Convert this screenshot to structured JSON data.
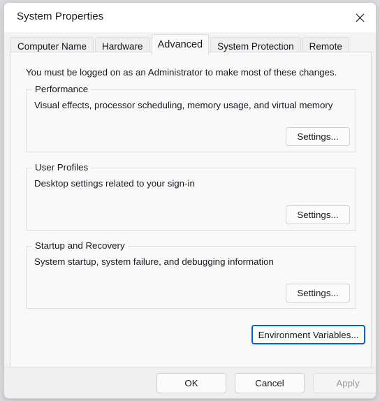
{
  "window": {
    "title": "System Properties",
    "close_icon": "close-icon"
  },
  "tabs": [
    {
      "label": "Computer Name",
      "active": false
    },
    {
      "label": "Hardware",
      "active": false
    },
    {
      "label": "Advanced",
      "active": true
    },
    {
      "label": "System Protection",
      "active": false
    },
    {
      "label": "Remote",
      "active": false
    }
  ],
  "panel": {
    "admin_note": "You must be logged on as an Administrator to make most of these changes.",
    "groups": [
      {
        "legend": "Performance",
        "description": "Visual effects, processor scheduling, memory usage, and virtual memory",
        "button_label": "Settings..."
      },
      {
        "legend": "User Profiles",
        "description": "Desktop settings related to your sign-in",
        "button_label": "Settings..."
      },
      {
        "legend": "Startup and Recovery",
        "description": "System startup, system failure, and debugging information",
        "button_label": "Settings..."
      }
    ],
    "environment_variables_label": "Environment Variables..."
  },
  "footer": {
    "ok_label": "OK",
    "cancel_label": "Cancel",
    "apply_label": "Apply"
  },
  "colors": {
    "focus_border": "#0066cc",
    "window_background": "#f3f3f3",
    "panel_background": "#f9f9f9",
    "footer_background": "#efefef",
    "text": "#14191f",
    "disabled_text": "#9a9a9a"
  }
}
